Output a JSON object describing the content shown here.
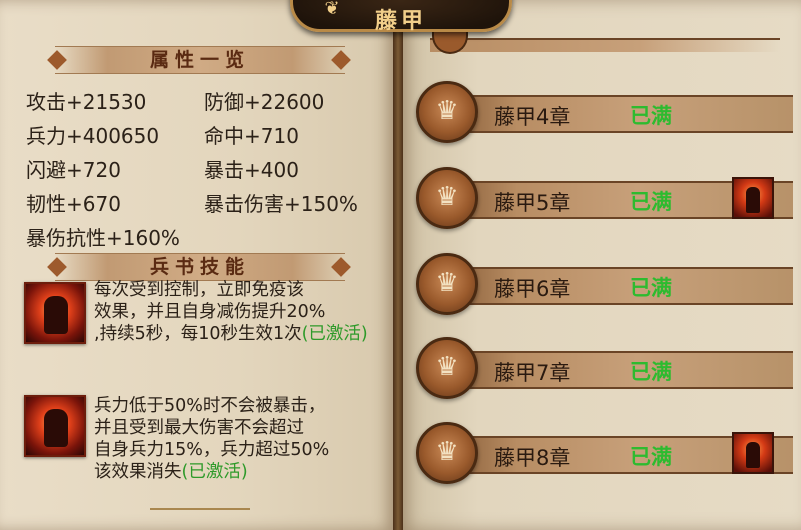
{
  "window": {
    "title": "藤甲"
  },
  "attributes_panel": {
    "header": "属性一览",
    "stats": [
      {
        "label": "攻击+21530"
      },
      {
        "label": "防御+22600"
      },
      {
        "label": "兵力+400650"
      },
      {
        "label": "命中+710"
      },
      {
        "label": "闪避+720"
      },
      {
        "label": "暴击+400"
      },
      {
        "label": "韧性+670"
      },
      {
        "label": "暴击伤害+150%"
      },
      {
        "label": "暴伤抗性+160%"
      }
    ]
  },
  "skills_panel": {
    "header": "兵书技能",
    "skills": [
      {
        "icon": "warrior-portrait-icon",
        "lines": [
          "每次受到控制，立即免疫该",
          "效果，并且自身减伤提升20%",
          ",持续5秒，每10秒生效1次"
        ],
        "status": "(已激活)"
      },
      {
        "icon": "berserker-portrait-icon",
        "lines": [
          "兵力低于50%时不会被暴击，",
          "并且受到最大伤害不会超过",
          "自身兵力15%，兵力超过50%",
          "该效果消失"
        ],
        "status": "(已激活)"
      }
    ]
  },
  "chapters": [
    {
      "name": "藤甲4章",
      "status": "已满",
      "has_avatar": false
    },
    {
      "name": "藤甲5章",
      "status": "已满",
      "has_avatar": true
    },
    {
      "name": "藤甲6章",
      "status": "已满",
      "has_avatar": false
    },
    {
      "name": "藤甲7章",
      "status": "已满",
      "has_avatar": false
    },
    {
      "name": "藤甲8章",
      "status": "已满",
      "has_avatar": true
    }
  ],
  "colors": {
    "status_active": "#2e9a2a",
    "status_full": "#2dbb2f",
    "header_text": "#5a2a12",
    "parchment": "#e6dbc5"
  }
}
